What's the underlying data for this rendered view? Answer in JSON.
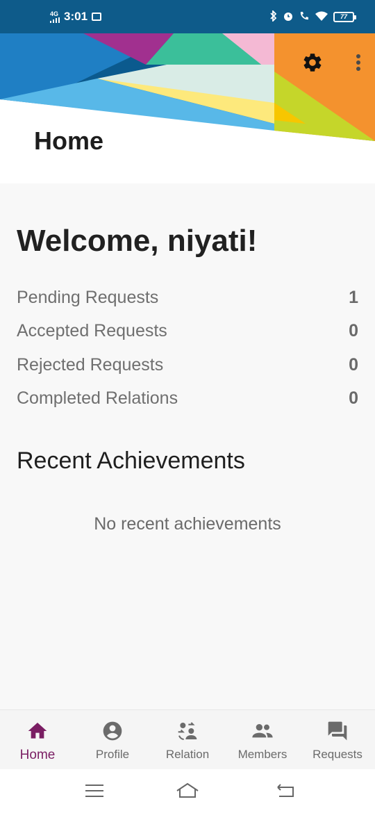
{
  "status_bar": {
    "network": "4G",
    "time": "3:01",
    "icons": [
      "signal-icon",
      "message-icon",
      "bluetooth-icon",
      "alarm-icon",
      "call-icon",
      "wifi-icon",
      "battery-icon"
    ],
    "battery": "77"
  },
  "header": {
    "title": "Home",
    "actions": [
      "gear-icon",
      "more-vert-icon"
    ],
    "colors": {
      "orange": "#f4922e",
      "lime": "#c5d62a",
      "yellow": "#fde97c",
      "blue": "#58b8e8",
      "dark_blue": "#0e5b8a",
      "purple": "#a1308f",
      "green": "#3bbf9a",
      "pink": "#f4b9d4"
    }
  },
  "main": {
    "welcome": "Welcome, niyati!",
    "stats": [
      {
        "label": "Pending Requests",
        "value": "1"
      },
      {
        "label": "Accepted Requests",
        "value": "0"
      },
      {
        "label": "Rejected Requests",
        "value": "0"
      },
      {
        "label": "Completed Relations",
        "value": "0"
      }
    ],
    "achievements_title": "Recent Achievements",
    "achievements_empty": "No recent achievements"
  },
  "bottom_nav": {
    "active_color": "#7a1e63",
    "items": [
      {
        "label": "Home",
        "icon": "home-icon",
        "active": true
      },
      {
        "label": "Profile",
        "icon": "profile-icon",
        "active": false
      },
      {
        "label": "Relation",
        "icon": "relation-icon",
        "active": false
      },
      {
        "label": "Members",
        "icon": "members-icon",
        "active": false
      },
      {
        "label": "Requests",
        "icon": "requests-icon",
        "active": false
      }
    ]
  },
  "system_nav": [
    "menu-icon",
    "home-outline-icon",
    "back-icon"
  ]
}
